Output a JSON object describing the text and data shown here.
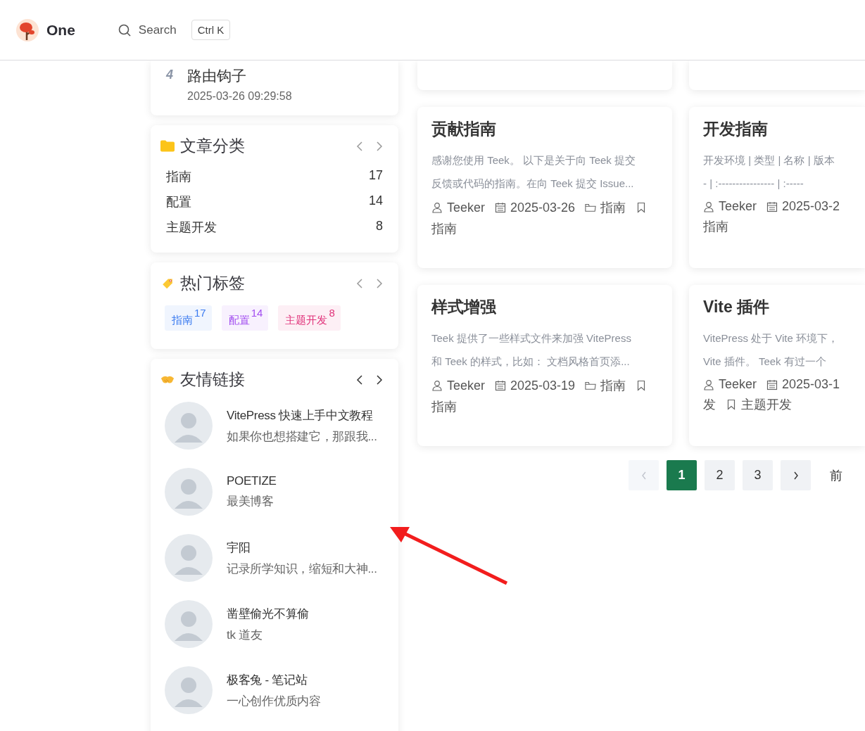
{
  "header": {
    "site_name": "One",
    "search": {
      "label": "Search",
      "shortcut": "Ctrl K"
    }
  },
  "sidebar": {
    "hot_list": [
      {
        "rank": "4",
        "title": "路由钩子",
        "time": "2025-03-26 09:29:58"
      }
    ],
    "widgets": [
      {
        "kind": "categories",
        "title": "文章分类",
        "items": [
          {
            "name": "指南",
            "count": "17"
          },
          {
            "name": "配置",
            "count": "14"
          },
          {
            "name": "主题开发",
            "count": "8"
          }
        ]
      },
      {
        "kind": "tags",
        "title": "热门标签",
        "items": [
          {
            "name": "指南",
            "count": "17",
            "color": "#3b7bf0"
          },
          {
            "name": "配置",
            "count": "14",
            "color": "#a24ef0"
          },
          {
            "name": "主题开发",
            "count": "8",
            "color": "#e0327a"
          }
        ]
      },
      {
        "kind": "links",
        "title": "友情链接",
        "items": [
          {
            "name": "VitePress 快速上手中文教程",
            "desc": "如果你也想搭建它，那跟我..."
          },
          {
            "name": "POETIZE",
            "desc": "最美博客"
          },
          {
            "name": "宇阳",
            "desc": "记录所学知识，缩短和大神..."
          },
          {
            "name": "凿壁偷光不算偷",
            "desc": "tk 道友"
          },
          {
            "name": "极客兔 - 笔记站",
            "desc": "一心创作优质内容"
          }
        ]
      }
    ]
  },
  "articles": [
    {
      "title": "贡献指南",
      "desc": [
        "感谢您使用 Teek。 以下是关于向 Teek 提交",
        "反馈或代码的指南。在向 Teek 提交 Issue..."
      ],
      "meta_lines": [
        [
          {
            "kind": "author",
            "text": "Teeker"
          },
          {
            "kind": "date",
            "text": "2025-03-26"
          },
          {
            "kind": "category",
            "text": "指南"
          },
          {
            "kind": "tag"
          }
        ],
        [
          {
            "kind": "text",
            "text": "指南"
          }
        ]
      ]
    },
    {
      "title": "开发指南",
      "desc": [
        "开发环境 | 类型 | 名称 | 版本",
        "- | :---------------- | :-----"
      ],
      "meta_lines": [
        [
          {
            "kind": "author",
            "text": "Teeker"
          },
          {
            "kind": "date",
            "text": "2025-03-2"
          }
        ],
        [
          {
            "kind": "text",
            "text": "指南"
          }
        ]
      ]
    },
    {
      "title": "样式增强",
      "desc": [
        "Teek 提供了一些样式文件来加强 VitePress",
        "和 Teek 的样式，比如： 文档风格首页添..."
      ],
      "meta_lines": [
        [
          {
            "kind": "author",
            "text": "Teeker"
          },
          {
            "kind": "date",
            "text": "2025-03-19"
          },
          {
            "kind": "category",
            "text": "指南"
          },
          {
            "kind": "tag"
          }
        ],
        [
          {
            "kind": "text",
            "text": "指南"
          }
        ]
      ]
    },
    {
      "title": "Vite 插件",
      "desc": [
        "VitePress 处于 Vite 环境下，",
        "Vite 插件。 Teek 有过一个"
      ],
      "meta_lines": [
        [
          {
            "kind": "author",
            "text": "Teeker"
          },
          {
            "kind": "date",
            "text": "2025-03-1"
          }
        ],
        [
          {
            "kind": "text",
            "text": "发"
          },
          {
            "kind": "tag",
            "text": "主题开发"
          }
        ]
      ]
    }
  ],
  "pagination": {
    "prev": {
      "disabled": true
    },
    "pages": [
      {
        "label": "1",
        "selected": true
      },
      {
        "label": "2",
        "selected": false
      },
      {
        "label": "3",
        "selected": false
      }
    ],
    "next": {
      "disabled": false
    },
    "goto": "前"
  }
}
